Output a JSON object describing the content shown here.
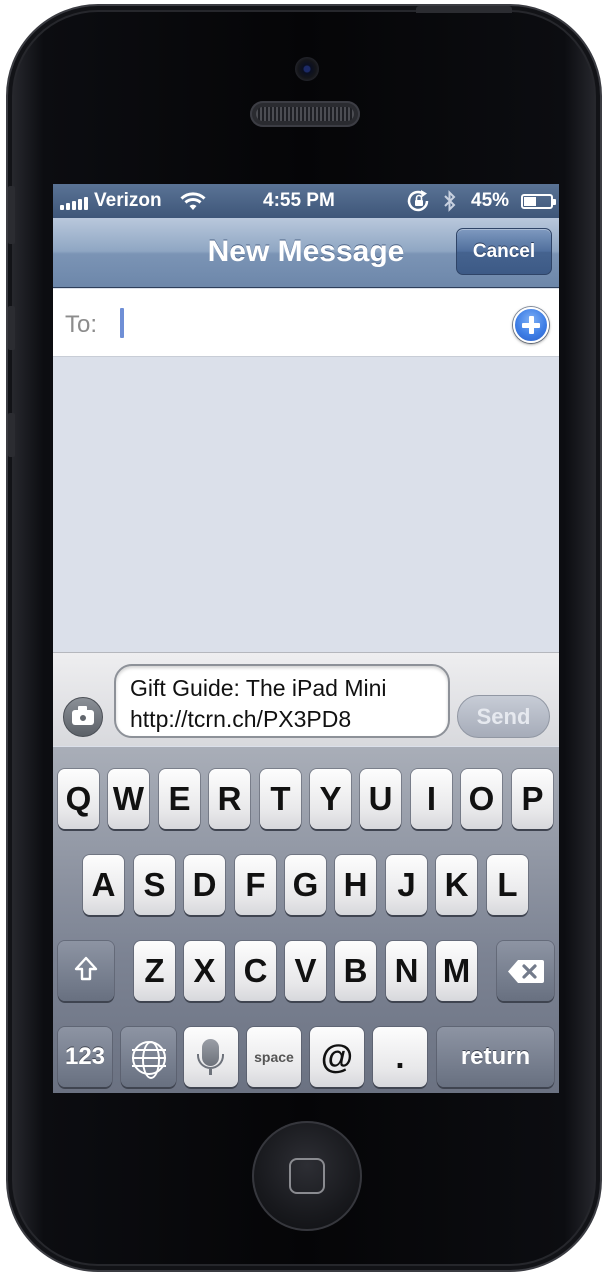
{
  "status_bar": {
    "carrier": "Verizon",
    "time": "4:55 PM",
    "battery_percent": "45%",
    "battery_level": 0.45,
    "icons": [
      "signal-bars-icon",
      "wifi-icon",
      "rotation-lock-icon",
      "bluetooth-icon",
      "battery-icon"
    ]
  },
  "nav": {
    "title": "New Message",
    "cancel_label": "Cancel"
  },
  "recipient": {
    "label": "To:",
    "value": "",
    "add_contact_icon": "plus-circle-icon"
  },
  "compose": {
    "message_text": "Gift Guide: The iPad Mini\nhttp://tcrn.ch/PX3PD8",
    "send_label": "Send",
    "camera_icon": "camera-icon"
  },
  "keyboard": {
    "row1": [
      "Q",
      "W",
      "E",
      "R",
      "T",
      "Y",
      "U",
      "I",
      "O",
      "P"
    ],
    "row2": [
      "A",
      "S",
      "D",
      "F",
      "G",
      "H",
      "J",
      "K",
      "L"
    ],
    "row3": [
      "Z",
      "X",
      "C",
      "V",
      "B",
      "N",
      "M"
    ],
    "numbers_label": "123",
    "space_label": "space",
    "at_label": "@",
    "period_label": ".",
    "return_label": "return",
    "icons": [
      "shift-icon",
      "backspace-icon",
      "globe-icon",
      "microphone-icon"
    ]
  },
  "colors": {
    "nav_bar": "#7b94b5",
    "status_bar": "#4a6285",
    "thread_background": "#dbe0ea",
    "add_contact_blue": "#3f7fe6",
    "cursor_blue": "#6f8fd6"
  }
}
